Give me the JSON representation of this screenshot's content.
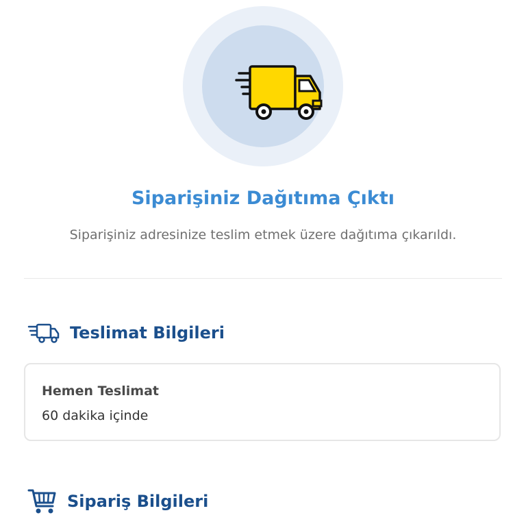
{
  "status": {
    "title": "Siparişiniz Dağıtıma Çıktı",
    "subtitle": "Siparişiniz adresinize teslim etmek üzere dağıtıma çıkarıldı.",
    "icon": "delivery-truck-icon",
    "colors": {
      "title": "#3b8bd3",
      "truck_body": "#ffd800",
      "circle_outer": "#eaf0f8",
      "circle_inner": "#cddcee"
    }
  },
  "delivery_info": {
    "heading": "Teslimat Bilgileri",
    "icon": "fast-truck-icon",
    "card": {
      "title": "Hemen Teslimat",
      "value": "60 dakika içinde"
    }
  },
  "order_info": {
    "heading": "Sipariş Bilgileri",
    "icon": "shopping-cart-icon"
  }
}
